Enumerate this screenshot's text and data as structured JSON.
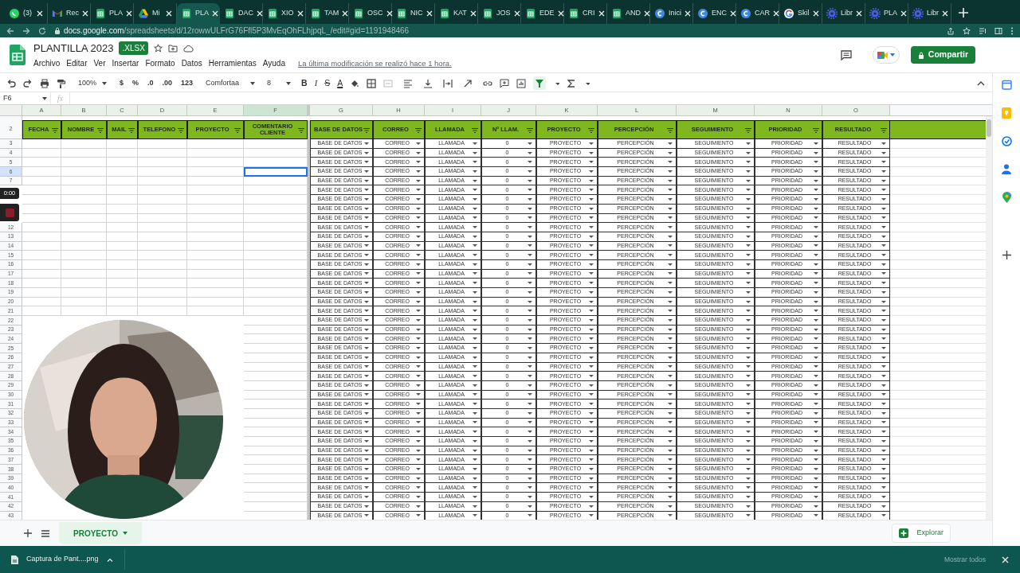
{
  "browser": {
    "tabs": [
      {
        "kind": "whatsapp",
        "label": "(3)",
        "selected": false
      },
      {
        "kind": "gmail",
        "label": "Rec",
        "selected": false
      },
      {
        "kind": "sheets",
        "label": "PLA",
        "selected": false
      },
      {
        "kind": "drive",
        "label": "Mi",
        "selected": false
      },
      {
        "kind": "sheets",
        "label": "PLA",
        "selected": true
      },
      {
        "kind": "sheets",
        "label": "DAC",
        "selected": false
      },
      {
        "kind": "sheets",
        "label": "XIO",
        "selected": false
      },
      {
        "kind": "sheets",
        "label": "TAM",
        "selected": false
      },
      {
        "kind": "sheets",
        "label": "OSC",
        "selected": false
      },
      {
        "kind": "sheets",
        "label": "NIC",
        "selected": false
      },
      {
        "kind": "sheets",
        "label": "KAT",
        "selected": false
      },
      {
        "kind": "sheets",
        "label": "JOS",
        "selected": false
      },
      {
        "kind": "sheets",
        "label": "EDE",
        "selected": false
      },
      {
        "kind": "sheets",
        "label": "CRI",
        "selected": false
      },
      {
        "kind": "sheets",
        "label": "AND",
        "selected": false
      },
      {
        "kind": "canva",
        "label": "Inici",
        "selected": false
      },
      {
        "kind": "canva",
        "label": "ENC",
        "selected": false
      },
      {
        "kind": "canva",
        "label": "CAR",
        "selected": false
      },
      {
        "kind": "google",
        "label": "Skil",
        "selected": false
      },
      {
        "kind": "gear",
        "label": "Libr",
        "selected": false
      },
      {
        "kind": "gear",
        "label": "PLA",
        "selected": false
      },
      {
        "kind": "gear",
        "label": "Libr",
        "selected": false
      }
    ],
    "url_host": "docs.google.com",
    "url_path": "/spreadsheets/d/12rowwULFrG76Ffl5P3MvEqOhFLhjpqL_/edit#gid=1191948466"
  },
  "document": {
    "title": "PLANTILLA 2023",
    "badge": ".XLSX",
    "menus": [
      "Archivo",
      "Editar",
      "Ver",
      "Insertar",
      "Formato",
      "Datos",
      "Herramientas",
      "Ayuda"
    ],
    "last_edit": "La última modificación se realizó hace 1 hora.",
    "share_button": "Compartir"
  },
  "toolbar": {
    "zoom": "100%",
    "format_buttons": [
      "$",
      "%",
      ".0",
      ".00",
      "123"
    ],
    "font": "Comfortaa",
    "font_size": "8",
    "style_buttons": [
      "B",
      "I",
      "S",
      "A"
    ],
    "filter_active": true
  },
  "formula_bar": {
    "cell_ref": "F6",
    "fx": "fx"
  },
  "columns": [
    {
      "letter": "A",
      "header": "FECHA",
      "selected": false
    },
    {
      "letter": "B",
      "header": "NOMBRE",
      "selected": false
    },
    {
      "letter": "C",
      "header": "MAIL",
      "selected": false
    },
    {
      "letter": "D",
      "header": "TELEFONO",
      "selected": false
    },
    {
      "letter": "E",
      "header": "PROYECTO",
      "selected": false
    },
    {
      "letter": "F",
      "header": "COMENTARIO CLIENTE",
      "selected": true
    },
    {
      "letter": "G",
      "header": "BASE DE DATOS",
      "selected": false
    },
    {
      "letter": "H",
      "header": "CORREO",
      "selected": false
    },
    {
      "letter": "I",
      "header": "LLAMADA",
      "selected": false
    },
    {
      "letter": "J",
      "header": "Nº LLAM.",
      "selected": false
    },
    {
      "letter": "K",
      "header": "PROYECTO",
      "selected": false
    },
    {
      "letter": "L",
      "header": "PERCEPCIÓN",
      "selected": false
    },
    {
      "letter": "M",
      "header": "SEGUIMIENTO",
      "selected": false
    },
    {
      "letter": "N",
      "header": "PRIORIDAD",
      "selected": false
    },
    {
      "letter": "O",
      "header": "RESULTADO",
      "selected": false
    }
  ],
  "header_row": "2",
  "rows": [
    {
      "n": "3",
      "selected": false,
      "values": [
        "BASE DE DATOS",
        "CORREO",
        "LLAMADA",
        "0",
        "PROYECTO",
        "PERCEPCIÓN",
        "SEGUIMIENTO",
        "PRIORIDAD",
        "RESULTADO"
      ]
    },
    {
      "n": "4",
      "selected": false,
      "values": [
        "BASE DE DATOS",
        "CORREO",
        "LLAMADA",
        "0",
        "PROYECTO",
        "PERCEPCIÓN",
        "SEGUIMIENTO",
        "PRIORIDAD",
        "RESULTADO"
      ]
    },
    {
      "n": "5",
      "selected": false,
      "values": [
        "BASE DE DATOS",
        "CORREO",
        "LLAMADA",
        "0",
        "PROYECTO",
        "PERCEPCIÓN",
        "SEGUIMIENTO",
        "PRIORIDAD",
        "RESULTADO"
      ]
    },
    {
      "n": "6",
      "selected": true,
      "values": [
        "BASE DE DATOS",
        "CORREO",
        "LLAMADA",
        "0",
        "PROYECTO",
        "PERCEPCIÓN",
        "SEGUIMIENTO",
        "PRIORIDAD",
        "RESULTADO"
      ]
    },
    {
      "n": "7",
      "selected": false,
      "values": [
        "BASE DE DATOS",
        "CORREO",
        "LLAMADA",
        "0",
        "PROYECTO",
        "PERCEPCIÓN",
        "SEGUIMIENTO",
        "PRIORIDAD",
        "RESULTADO"
      ]
    },
    {
      "selected": false,
      "values": [
        "BASE DE DATOS",
        "CORREO",
        "LLAMADA",
        "0",
        "PROYECTO",
        "PERCEPCIÓN",
        "SEGUIMIENTO",
        "PRIORIDAD",
        "RESULTADO"
      ]
    },
    {
      "selected": false,
      "values": [
        "BASE DE DATOS",
        "CORREO",
        "LLAMADA",
        "0",
        "PROYECTO",
        "PERCEPCIÓN",
        "SEGUIMIENTO",
        "PRIORIDAD",
        "RESULTADO"
      ]
    },
    {
      "selected": false,
      "values": [
        "BASE DE DATOS",
        "CORREO",
        "LLAMADA",
        "0",
        "PROYECTO",
        "PERCEPCIÓN",
        "SEGUIMIENTO",
        "PRIORIDAD",
        "RESULTADO"
      ]
    },
    {
      "selected": false,
      "values": [
        "BASE DE DATOS",
        "CORREO",
        "LLAMADA",
        "0",
        "PROYECTO",
        "PERCEPCIÓN",
        "SEGUIMIENTO",
        "PRIORIDAD",
        "RESULTADO"
      ]
    },
    {
      "n": "12",
      "selected": false,
      "values": [
        "BASE DE DATOS",
        "CORREO",
        "LLAMADA",
        "0",
        "PROYECTO",
        "PERCEPCIÓN",
        "SEGUIMIENTO",
        "PRIORIDAD",
        "RESULTADO"
      ]
    },
    {
      "n": "13",
      "selected": false,
      "values": [
        "BASE DE DATOS",
        "CORREO",
        "LLAMADA",
        "0",
        "PROYECTO",
        "PERCEPCIÓN",
        "SEGUIMIENTO",
        "PRIORIDAD",
        "RESULTADO"
      ]
    },
    {
      "n": "14",
      "selected": false,
      "values": [
        "BASE DE DATOS",
        "CORREO",
        "LLAMADA",
        "0",
        "PROYECTO",
        "PERCEPCIÓN",
        "SEGUIMIENTO",
        "PRIORIDAD",
        "RESULTADO"
      ]
    },
    {
      "n": "15",
      "selected": false,
      "values": [
        "BASE DE DATOS",
        "CORREO",
        "LLAMADA",
        "0",
        "PROYECTO",
        "PERCEPCIÓN",
        "SEGUIMIENTO",
        "PRIORIDAD",
        "RESULTADO"
      ]
    },
    {
      "n": "16",
      "selected": false,
      "values": [
        "BASE DE DATOS",
        "CORREO",
        "LLAMADA",
        "0",
        "PROYECTO",
        "PERCEPCIÓN",
        "SEGUIMIENTO",
        "PRIORIDAD",
        "RESULTADO"
      ]
    },
    {
      "n": "17",
      "selected": false,
      "values": [
        "BASE DE DATOS",
        "CORREO",
        "LLAMADA",
        "0",
        "PROYECTO",
        "PERCEPCIÓN",
        "SEGUIMIENTO",
        "PRIORIDAD",
        "RESULTADO"
      ]
    },
    {
      "n": "18",
      "selected": false,
      "values": [
        "BASE DE DATOS",
        "CORREO",
        "LLAMADA",
        "0",
        "PROYECTO",
        "PERCEPCIÓN",
        "SEGUIMIENTO",
        "PRIORIDAD",
        "RESULTADO"
      ]
    },
    {
      "n": "19",
      "selected": false,
      "values": [
        "BASE DE DATOS",
        "CORREO",
        "LLAMADA",
        "0",
        "PROYECTO",
        "PERCEPCIÓN",
        "SEGUIMIENTO",
        "PRIORIDAD",
        "RESULTADO"
      ]
    },
    {
      "n": "20",
      "selected": false,
      "values": [
        "BASE DE DATOS",
        "CORREO",
        "LLAMADA",
        "0",
        "PROYECTO",
        "PERCEPCIÓN",
        "SEGUIMIENTO",
        "PRIORIDAD",
        "RESULTADO"
      ]
    },
    {
      "n": "21",
      "selected": false,
      "values": [
        "BASE DE DATOS",
        "CORREO",
        "LLAMADA",
        "0",
        "PROYECTO",
        "PERCEPCIÓN",
        "SEGUIMIENTO",
        "PRIORIDAD",
        "RESULTADO"
      ]
    },
    {
      "n": "22",
      "selected": false,
      "values": [
        "BASE DE DATOS",
        "CORREO",
        "LLAMADA",
        "0",
        "PROYECTO",
        "PERCEPCIÓN",
        "SEGUIMIENTO",
        "PRIORIDAD",
        "RESULTADO"
      ]
    },
    {
      "n": "23",
      "selected": false,
      "values": [
        "BASE DE DATOS",
        "CORREO",
        "LLAMADA",
        "0",
        "PROYECTO",
        "PERCEPCIÓN",
        "SEGUIMIENTO",
        "PRIORIDAD",
        "RESULTADO"
      ]
    },
    {
      "n": "24",
      "selected": false,
      "values": [
        "BASE DE DATOS",
        "CORREO",
        "LLAMADA",
        "0",
        "PROYECTO",
        "PERCEPCIÓN",
        "SEGUIMIENTO",
        "PRIORIDAD",
        "RESULTADO"
      ]
    },
    {
      "n": "25",
      "selected": false,
      "values": [
        "BASE DE DATOS",
        "CORREO",
        "LLAMADA",
        "0",
        "PROYECTO",
        "PERCEPCIÓN",
        "SEGUIMIENTO",
        "PRIORIDAD",
        "RESULTADO"
      ]
    },
    {
      "n": "26",
      "selected": false,
      "values": [
        "BASE DE DATOS",
        "CORREO",
        "LLAMADA",
        "0",
        "PROYECTO",
        "PERCEPCIÓN",
        "SEGUIMIENTO",
        "PRIORIDAD",
        "RESULTADO"
      ]
    },
    {
      "n": "27",
      "selected": false,
      "values": [
        "BASE DE DATOS",
        "CORREO",
        "LLAMADA",
        "0",
        "PROYECTO",
        "PERCEPCIÓN",
        "SEGUIMIENTO",
        "PRIORIDAD",
        "RESULTADO"
      ]
    },
    {
      "n": "28",
      "selected": false,
      "values": [
        "BASE DE DATOS",
        "CORREO",
        "LLAMADA",
        "0",
        "PROYECTO",
        "PERCEPCIÓN",
        "SEGUIMIENTO",
        "PRIORIDAD",
        "RESULTADO"
      ]
    },
    {
      "n": "29",
      "selected": false,
      "values": [
        "BASE DE DATOS",
        "CORREO",
        "LLAMADA",
        "0",
        "PROYECTO",
        "PERCEPCIÓN",
        "SEGUIMIENTO",
        "PRIORIDAD",
        "RESULTADO"
      ]
    },
    {
      "n": "30",
      "selected": false,
      "values": [
        "BASE DE DATOS",
        "CORREO",
        "LLAMADA",
        "0",
        "PROYECTO",
        "PERCEPCIÓN",
        "SEGUIMIENTO",
        "PRIORIDAD",
        "RESULTADO"
      ]
    },
    {
      "n": "31",
      "selected": false,
      "values": [
        "BASE DE DATOS",
        "CORREO",
        "LLAMADA",
        "0",
        "PROYECTO",
        "PERCEPCIÓN",
        "SEGUIMIENTO",
        "PRIORIDAD",
        "RESULTADO"
      ]
    },
    {
      "n": "32",
      "selected": false,
      "values": [
        "BASE DE DATOS",
        "CORREO",
        "LLAMADA",
        "0",
        "PROYECTO",
        "PERCEPCIÓN",
        "SEGUIMIENTO",
        "PRIORIDAD",
        "RESULTADO"
      ]
    },
    {
      "n": "33",
      "selected": false,
      "values": [
        "BASE DE DATOS",
        "CORREO",
        "LLAMADA",
        "0",
        "PROYECTO",
        "PERCEPCIÓN",
        "SEGUIMIENTO",
        "PRIORIDAD",
        "RESULTADO"
      ]
    },
    {
      "n": "34",
      "selected": false,
      "values": [
        "BASE DE DATOS",
        "CORREO",
        "LLAMADA",
        "0",
        "PROYECTO",
        "PERCEPCIÓN",
        "SEGUIMIENTO",
        "PRIORIDAD",
        "RESULTADO"
      ]
    },
    {
      "n": "35",
      "selected": false,
      "values": [
        "BASE DE DATOS",
        "CORREO",
        "LLAMADA",
        "0",
        "PROYECTO",
        "PERCEPCIÓN",
        "SEGUIMIENTO",
        "PRIORIDAD",
        "RESULTADO"
      ]
    },
    {
      "n": "36",
      "selected": false,
      "values": [
        "BASE DE DATOS",
        "CORREO",
        "LLAMADA",
        "0",
        "PROYECTO",
        "PERCEPCIÓN",
        "SEGUIMIENTO",
        "PRIORIDAD",
        "RESULTADO"
      ]
    },
    {
      "n": "37",
      "selected": false,
      "values": [
        "BASE DE DATOS",
        "CORREO",
        "LLAMADA",
        "0",
        "PROYECTO",
        "PERCEPCIÓN",
        "SEGUIMIENTO",
        "PRIORIDAD",
        "RESULTADO"
      ]
    },
    {
      "n": "38",
      "selected": false,
      "values": [
        "BASE DE DATOS",
        "CORREO",
        "LLAMADA",
        "0",
        "PROYECTO",
        "PERCEPCIÓN",
        "SEGUIMIENTO",
        "PRIORIDAD",
        "RESULTADO"
      ]
    },
    {
      "n": "39",
      "selected": false,
      "values": [
        "BASE DE DATOS",
        "CORREO",
        "LLAMADA",
        "0",
        "PROYECTO",
        "PERCEPCIÓN",
        "SEGUIMIENTO",
        "PRIORIDAD",
        "RESULTADO"
      ]
    },
    {
      "n": "40",
      "selected": false,
      "values": [
        "BASE DE DATOS",
        "CORREO",
        "LLAMADA",
        "0",
        "PROYECTO",
        "PERCEPCIÓN",
        "SEGUIMIENTO",
        "PRIORIDAD",
        "RESULTADO"
      ]
    },
    {
      "n": "41",
      "selected": false,
      "values": [
        "BASE DE DATOS",
        "CORREO",
        "LLAMADA",
        "0",
        "PROYECTO",
        "PERCEPCIÓN",
        "SEGUIMIENTO",
        "PRIORIDAD",
        "RESULTADO"
      ]
    },
    {
      "n": "42",
      "selected": false,
      "values": [
        "BASE DE DATOS",
        "CORREO",
        "LLAMADA",
        "0",
        "PROYECTO",
        "PERCEPCIÓN",
        "SEGUIMIENTO",
        "PRIORIDAD",
        "RESULTADO"
      ]
    },
    {
      "n": "43",
      "selected": false,
      "values": [
        "BASE DE DATOS",
        "CORREO",
        "LLAMADA",
        "0",
        "PROYECTO",
        "PERCEPCIÓN",
        "SEGUIMIENTO",
        "PRIORIDAD",
        "RESULTADO"
      ]
    }
  ],
  "sheets": [
    {
      "label": "PROYECTO",
      "selected": true
    }
  ],
  "explore_button": "Explorar",
  "recording": {
    "timer": "0:00"
  },
  "download_bar": {
    "file": "Captura de Pant....png",
    "show_all": "Mostrar todos"
  }
}
